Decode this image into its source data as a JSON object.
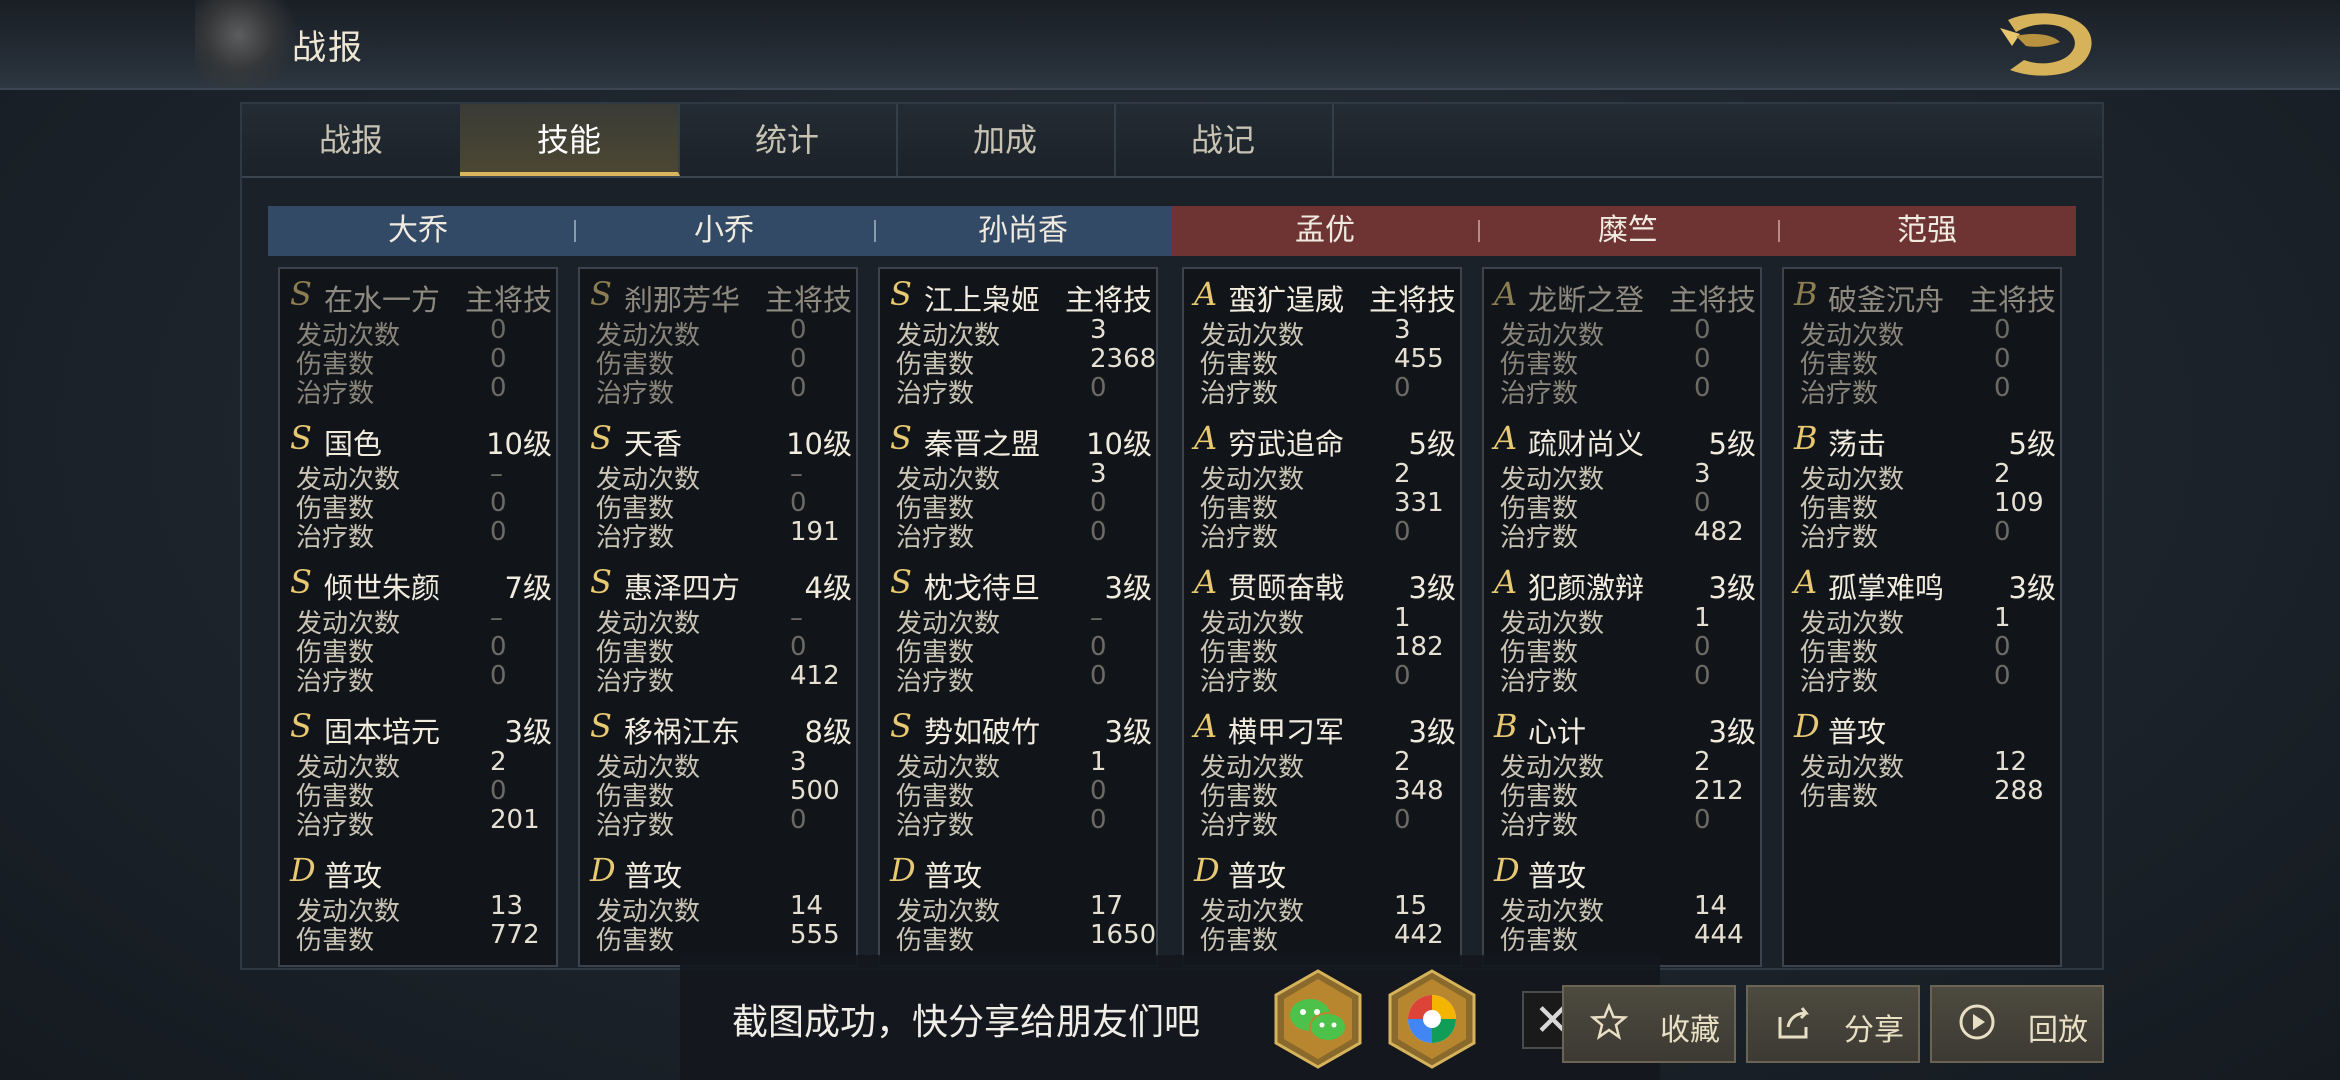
{
  "header": {
    "title": "战报"
  },
  "tabs": [
    {
      "label": "战报"
    },
    {
      "label": "技能"
    },
    {
      "label": "统计"
    },
    {
      "label": "加成"
    },
    {
      "label": "战记"
    }
  ],
  "active_tab": "技能",
  "stat_labels": {
    "trigger": "发动次数",
    "damage": "伤害数",
    "heal": "治疗数"
  },
  "heroes": [
    {
      "name": "大乔",
      "side": "blue",
      "skills": [
        {
          "grade": "S",
          "name": "在水一方",
          "level": "主将技",
          "dim": true,
          "trigger": "0",
          "damage": "0",
          "heal": "0"
        },
        {
          "grade": "S",
          "name": "国色",
          "level": "10级",
          "trigger": "–",
          "damage": "0",
          "heal": "0"
        },
        {
          "grade": "S",
          "name": "倾世朱颜",
          "level": "7级",
          "trigger": "–",
          "damage": "0",
          "heal": "0"
        },
        {
          "grade": "S",
          "name": "固本培元",
          "level": "3级",
          "trigger": "2",
          "damage": "0",
          "heal": "201"
        },
        {
          "grade": "D",
          "name": "普攻",
          "level": "",
          "trigger": "13",
          "damage": "772"
        }
      ]
    },
    {
      "name": "小乔",
      "side": "blue",
      "skills": [
        {
          "grade": "S",
          "name": "刹那芳华",
          "level": "主将技",
          "dim": true,
          "trigger": "0",
          "damage": "0",
          "heal": "0"
        },
        {
          "grade": "S",
          "name": "天香",
          "level": "10级",
          "trigger": "–",
          "damage": "0",
          "heal": "191"
        },
        {
          "grade": "S",
          "name": "惠泽四方",
          "level": "4级",
          "trigger": "–",
          "damage": "0",
          "heal": "412"
        },
        {
          "grade": "S",
          "name": "移祸江东",
          "level": "8级",
          "trigger": "3",
          "damage": "500",
          "heal": "0"
        },
        {
          "grade": "D",
          "name": "普攻",
          "level": "",
          "trigger": "14",
          "damage": "555"
        }
      ]
    },
    {
      "name": "孙尚香",
      "side": "blue",
      "skills": [
        {
          "grade": "S",
          "name": "江上枭姬",
          "level": "主将技",
          "trigger": "3",
          "damage": "2368",
          "heal": "0"
        },
        {
          "grade": "S",
          "name": "秦晋之盟",
          "level": "10级",
          "trigger": "3",
          "damage": "0",
          "heal": "0"
        },
        {
          "grade": "S",
          "name": "枕戈待旦",
          "level": "3级",
          "trigger": "–",
          "damage": "0",
          "heal": "0"
        },
        {
          "grade": "S",
          "name": "势如破竹",
          "level": "3级",
          "trigger": "1",
          "damage": "0",
          "heal": "0"
        },
        {
          "grade": "D",
          "name": "普攻",
          "level": "",
          "trigger": "17",
          "damage": "1650"
        }
      ]
    },
    {
      "name": "孟优",
      "side": "red",
      "skills": [
        {
          "grade": "A",
          "name": "蛮犷逞威",
          "level": "主将技",
          "trigger": "3",
          "damage": "455",
          "heal": "0"
        },
        {
          "grade": "A",
          "name": "穷武追命",
          "level": "5级",
          "trigger": "2",
          "damage": "331",
          "heal": "0"
        },
        {
          "grade": "A",
          "name": "贯颐奋戟",
          "level": "3级",
          "trigger": "1",
          "damage": "182",
          "heal": "0"
        },
        {
          "grade": "A",
          "name": "横甲刁军",
          "level": "3级",
          "trigger": "2",
          "damage": "348",
          "heal": "0"
        },
        {
          "grade": "D",
          "name": "普攻",
          "level": "",
          "trigger": "15",
          "damage": "442"
        }
      ]
    },
    {
      "name": "糜竺",
      "side": "red",
      "skills": [
        {
          "grade": "A",
          "name": "龙断之登",
          "level": "主将技",
          "dim": true,
          "trigger": "0",
          "damage": "0",
          "heal": "0"
        },
        {
          "grade": "A",
          "name": "疏财尚义",
          "level": "5级",
          "trigger": "3",
          "damage": "0",
          "heal": "482"
        },
        {
          "grade": "A",
          "name": "犯颜激辩",
          "level": "3级",
          "trigger": "1",
          "damage": "0",
          "heal": "0"
        },
        {
          "grade": "B",
          "name": "心计",
          "level": "3级",
          "trigger": "2",
          "damage": "212",
          "heal": "0"
        },
        {
          "grade": "D",
          "name": "普攻",
          "level": "",
          "trigger": "14",
          "damage": "444"
        }
      ]
    },
    {
      "name": "范强",
      "side": "red",
      "skills": [
        {
          "grade": "B",
          "name": "破釜沉舟",
          "level": "主将技",
          "dim": true,
          "trigger": "0",
          "damage": "0",
          "heal": "0"
        },
        {
          "grade": "B",
          "name": "荡击",
          "level": "5级",
          "trigger": "2",
          "damage": "109",
          "heal": "0"
        },
        {
          "grade": "A",
          "name": "孤掌难鸣",
          "level": "3级",
          "trigger": "1",
          "damage": "0",
          "heal": "0"
        },
        {
          "grade": "D",
          "name": "普攻",
          "level": "",
          "trigger": "12",
          "damage": "288"
        }
      ]
    }
  ],
  "toast": {
    "text": "截图成功，快分享给朋友们吧"
  },
  "buttons": {
    "favorite": "收藏",
    "share": "分享",
    "replay": "回放"
  },
  "icons": {
    "wechat": "wechat-icon",
    "photos": "photos-icon",
    "close": "close-icon",
    "star": "star-icon",
    "share": "share-icon",
    "play": "play-icon",
    "dragon": "dragon-logo-icon"
  },
  "colors": {
    "accent_gold": "#d9b55d",
    "blue_team": "#334a66",
    "red_team": "#6e3434",
    "grade_gold": "#e8c870"
  }
}
